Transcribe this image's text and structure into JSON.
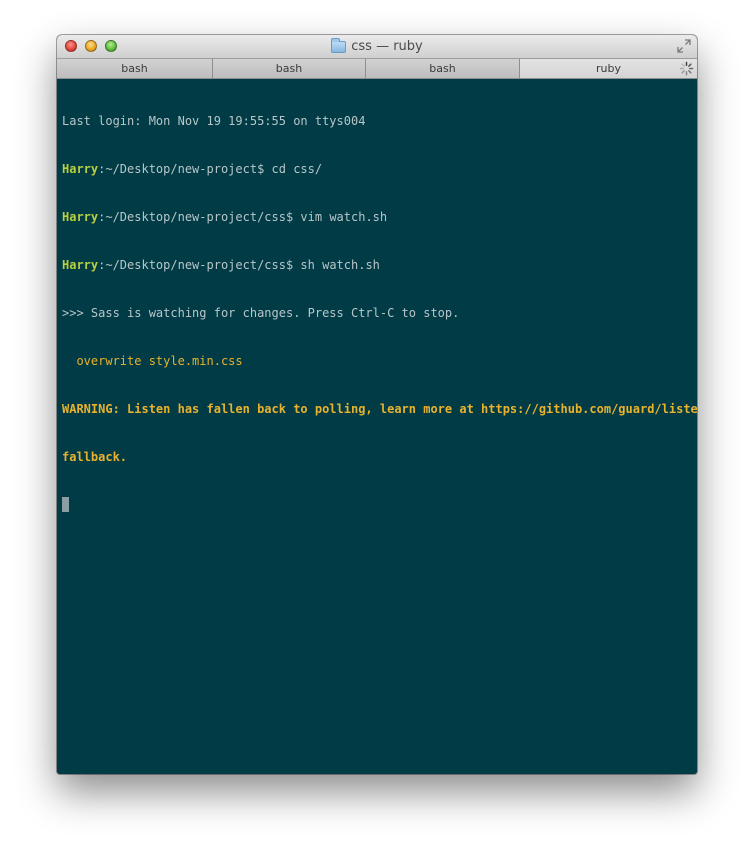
{
  "window": {
    "title": "css — ruby"
  },
  "tabs": [
    {
      "label": "bash",
      "active": false
    },
    {
      "label": "bash",
      "active": false
    },
    {
      "label": "bash",
      "active": false
    },
    {
      "label": "ruby",
      "active": true
    }
  ],
  "terminal": {
    "last_login": "Last login: Mon Nov 19 19:55:55 on ttys004",
    "user": "Harry",
    "cmd1": {
      "path": ":~/Desktop/new-project$ ",
      "command": "cd css/"
    },
    "cmd2": {
      "path": ":~/Desktop/new-project/css$ ",
      "command": "vim watch.sh"
    },
    "cmd3": {
      "path": ":~/Desktop/new-project/css$ ",
      "command": "sh watch.sh"
    },
    "sass_line": ">>> Sass is watching for changes. Press Ctrl-C to stop.",
    "overwrite_line": "  overwrite style.min.css",
    "warning_line1": "WARNING: Listen has fallen back to polling, learn more at https://github.com/guard/listen#",
    "warning_line2": "fallback."
  },
  "colors": {
    "terminal_bg": "#003b46",
    "prompt_user": "#b9cf3f",
    "warning": "#e9b22c",
    "text": "#b8c6c9"
  },
  "icons": {
    "close": "close-button-icon",
    "minimize": "minimize-button-icon",
    "zoom": "zoom-button-icon",
    "folder": "folder-icon",
    "fullscreen": "fullscreen-icon",
    "activity": "spinner-icon"
  }
}
